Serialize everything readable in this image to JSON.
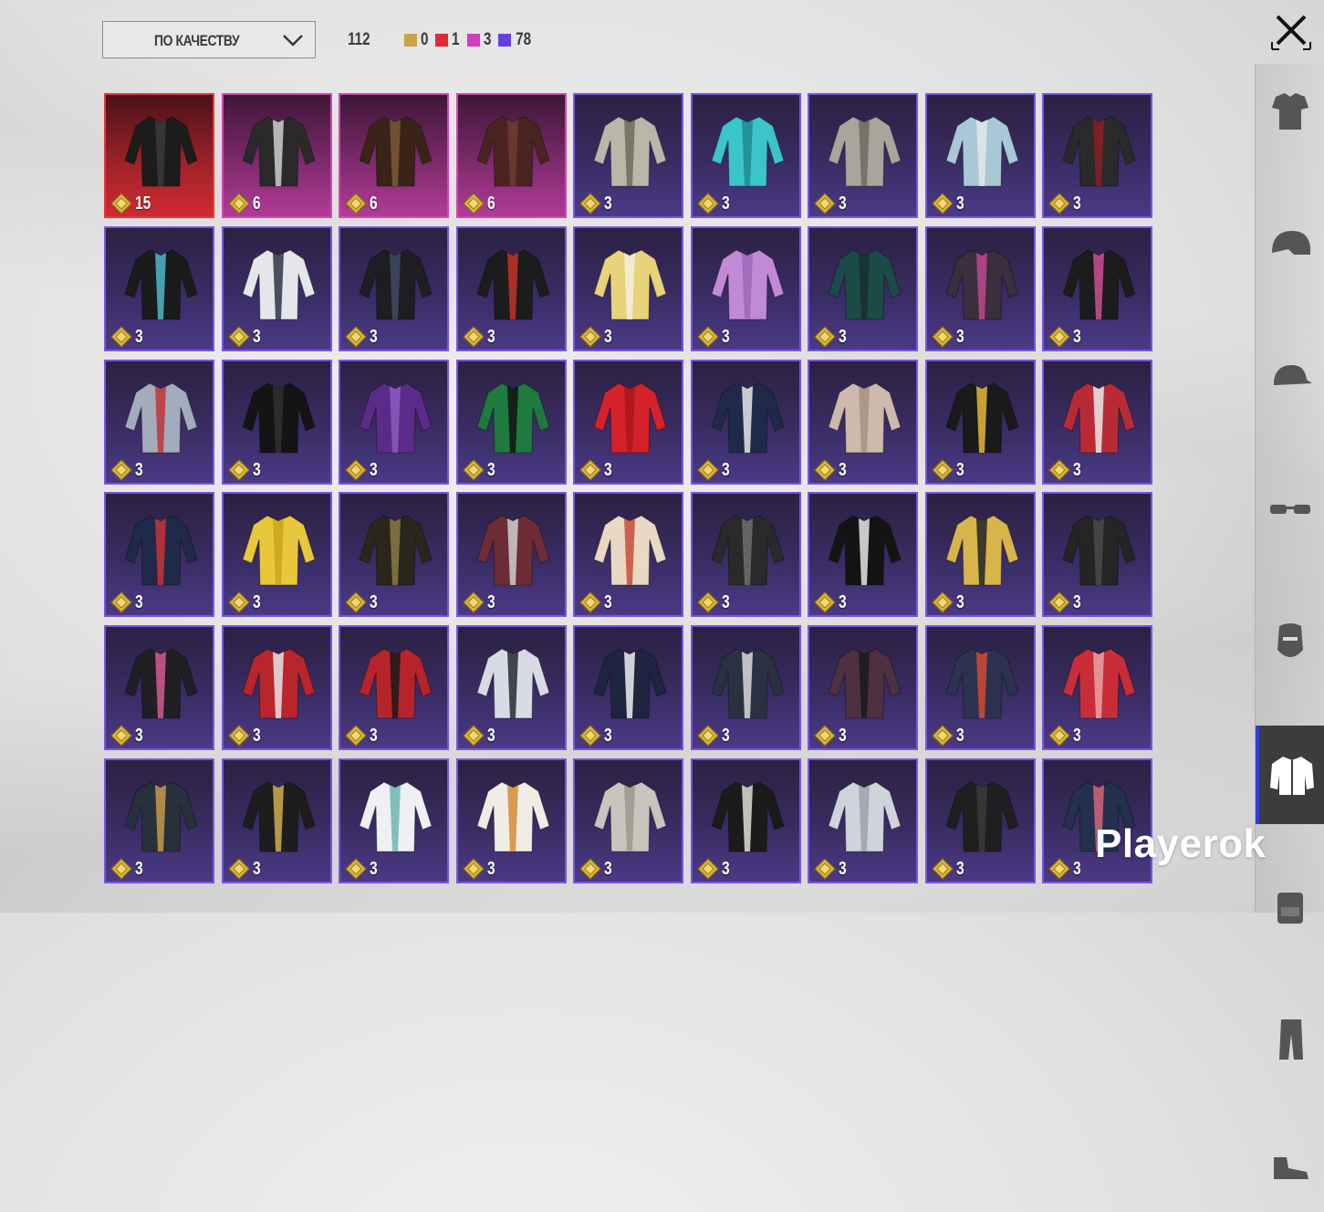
{
  "sort": {
    "label": "ПО КАЧЕСТВУ"
  },
  "counts": {
    "total": "112",
    "chips": [
      {
        "value": "0",
        "color": "#c9a447"
      },
      {
        "value": "1",
        "color": "#e02a33"
      },
      {
        "value": "3",
        "color": "#cf3dbd"
      },
      {
        "value": "78",
        "color": "#6a3de4"
      }
    ]
  },
  "items": [
    {
      "qty": "15",
      "quality": "red",
      "icon": "black-trench-coat"
    },
    {
      "qty": "6",
      "quality": "pink",
      "icon": "graffiti-bomber-jacket"
    },
    {
      "qty": "6",
      "quality": "pink",
      "icon": "hooded-long-coat"
    },
    {
      "qty": "6",
      "quality": "pink",
      "icon": "red-long-coat"
    },
    {
      "qty": "3",
      "quality": "purple",
      "icon": "camo-jacket"
    },
    {
      "qty": "3",
      "quality": "purple",
      "icon": "cyan-hoodie"
    },
    {
      "qty": "3",
      "quality": "purple",
      "icon": "grey-hoodie"
    },
    {
      "qty": "3",
      "quality": "purple",
      "icon": "floral-shirt"
    },
    {
      "qty": "3",
      "quality": "purple",
      "icon": "red-scarf-top"
    },
    {
      "qty": "3",
      "quality": "purple",
      "icon": "black-pubg-hoodie"
    },
    {
      "qty": "3",
      "quality": "purple",
      "icon": "white-kimono-jacket"
    },
    {
      "qty": "3",
      "quality": "purple",
      "icon": "black-harness"
    },
    {
      "qty": "3",
      "quality": "purple",
      "icon": "red-flame-jacket"
    },
    {
      "qty": "3",
      "quality": "purple",
      "icon": "yellow-jacket"
    },
    {
      "qty": "3",
      "quality": "purple",
      "icon": "lilac-crop-hoodie"
    },
    {
      "qty": "3",
      "quality": "purple",
      "icon": "green-hoodie"
    },
    {
      "qty": "3",
      "quality": "purple",
      "icon": "armor-vest"
    },
    {
      "qty": "3",
      "quality": "purple",
      "icon": "black-pink-jacket"
    },
    {
      "qty": "3",
      "quality": "purple",
      "icon": "denim-jacket"
    },
    {
      "qty": "3",
      "quality": "purple",
      "icon": "black-gear"
    },
    {
      "qty": "3",
      "quality": "purple",
      "icon": "purple-sleeves"
    },
    {
      "qty": "3",
      "quality": "purple",
      "icon": "green-hooded-armor"
    },
    {
      "qty": "3",
      "quality": "purple",
      "icon": "red-ducati-hoodie"
    },
    {
      "qty": "3",
      "quality": "purple",
      "icon": "navy-tshirt"
    },
    {
      "qty": "3",
      "quality": "purple",
      "icon": "bandage-wrap"
    },
    {
      "qty": "3",
      "quality": "purple",
      "icon": "black-gold-hoodie"
    },
    {
      "qty": "3",
      "quality": "purple",
      "icon": "red-white-jacket"
    },
    {
      "qty": "3",
      "quality": "purple",
      "icon": "navy-red-jacket"
    },
    {
      "qty": "3",
      "quality": "purple",
      "icon": "yellow-raincoat"
    },
    {
      "qty": "3",
      "quality": "purple",
      "icon": "black-gold-jacket"
    },
    {
      "qty": "3",
      "quality": "purple",
      "icon": "maroon-leather-jacket"
    },
    {
      "qty": "3",
      "quality": "purple",
      "icon": "clown-shirt"
    },
    {
      "qty": "3",
      "quality": "purple",
      "icon": "black-hooded-coat"
    },
    {
      "qty": "3",
      "quality": "purple",
      "icon": "walker-hoodie"
    },
    {
      "qty": "3",
      "quality": "purple",
      "icon": "gold-black-jacket"
    },
    {
      "qty": "3",
      "quality": "purple",
      "icon": "black-leather-jacket"
    },
    {
      "qty": "3",
      "quality": "purple",
      "icon": "black-pink-trim-jacket"
    },
    {
      "qty": "3",
      "quality": "purple",
      "icon": "red-hooded-cloak"
    },
    {
      "qty": "3",
      "quality": "purple",
      "icon": "red-hooded-jacket"
    },
    {
      "qty": "3",
      "quality": "purple",
      "icon": "white-hooded-coat"
    },
    {
      "qty": "3",
      "quality": "purple",
      "icon": "navy-suit-jacket"
    },
    {
      "qty": "3",
      "quality": "purple",
      "icon": "dark-hooded-jacket"
    },
    {
      "qty": "3",
      "quality": "purple",
      "icon": "maroon-hooded-jacket"
    },
    {
      "qty": "3",
      "quality": "purple",
      "icon": "joker-jacket"
    },
    {
      "qty": "3",
      "quality": "purple",
      "icon": "red-floral-shirt"
    },
    {
      "qty": "3",
      "quality": "purple",
      "icon": "dark-floral-tied-shirt"
    },
    {
      "qty": "3",
      "quality": "purple",
      "icon": "black-gold-tied-shirt"
    },
    {
      "qty": "3",
      "quality": "purple",
      "icon": "white-tattoo-shirt"
    },
    {
      "qty": "3",
      "quality": "purple",
      "icon": "white-orange-shirt"
    },
    {
      "qty": "3",
      "quality": "purple",
      "icon": "white-tied-shirt"
    },
    {
      "qty": "3",
      "quality": "purple",
      "icon": "skull-vest-jacket"
    },
    {
      "qty": "3",
      "quality": "purple",
      "icon": "white-lab-coat"
    },
    {
      "qty": "3",
      "quality": "purple",
      "icon": "black-military-jacket"
    },
    {
      "qty": "3",
      "quality": "purple",
      "icon": "floral-suit-jacket"
    }
  ],
  "sidebar": [
    {
      "name": "outfit-tab",
      "icon": "outfit-icon"
    },
    {
      "name": "helmet-tab",
      "icon": "helmet-icon"
    },
    {
      "name": "hat-tab",
      "icon": "cap-icon"
    },
    {
      "name": "glasses-tab",
      "icon": "glasses-icon"
    },
    {
      "name": "mask-tab",
      "icon": "mask-icon"
    },
    {
      "name": "jacket-tab",
      "icon": "jacket-icon",
      "active": true
    },
    {
      "name": "backpack-tab",
      "icon": "backpack-icon"
    },
    {
      "name": "pants-tab",
      "icon": "pants-icon"
    },
    {
      "name": "shoes-tab",
      "icon": "shoes-icon"
    }
  ],
  "watermark": "Playerok",
  "colors": {
    "purple_border": "#7d52e6",
    "red_border": "#e8353f",
    "pink_border": "#d644b5",
    "sidebar_active_accent": "#2b3fe0"
  }
}
